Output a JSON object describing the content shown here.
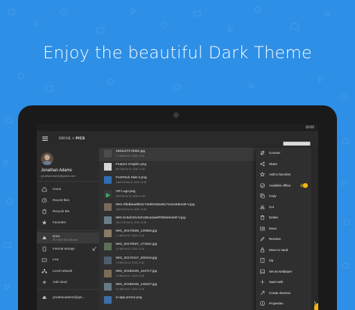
{
  "headline": "Enjoy the beautiful Dark Theme",
  "colors": {
    "background": "#2e8fe6",
    "app_dark": "#303030",
    "accent": "#f2b515"
  },
  "statusbar": {
    "time": "10:00"
  },
  "appbar": {
    "crumb_root": "DRIVE",
    "crumb_sep": ">",
    "crumb_current": "PICS",
    "icons": [
      "menu-icon",
      "sort-icon",
      "view-icon",
      "more-icon"
    ]
  },
  "drawer": {
    "user_name": "Jonathan Adams",
    "user_email": "jonathanadams@gmail.com",
    "items": [
      {
        "label": "Home",
        "icon": "home-icon"
      },
      {
        "label": "Recent files",
        "icon": "clock-icon"
      },
      {
        "label": "Recycle Bin",
        "icon": "trash-icon"
      },
      {
        "label": "Favorites",
        "icon": "star-icon"
      },
      {
        "label": "Drive",
        "sub": "35.7 GB of 50.0 GB used",
        "icon": "drive-icon"
      },
      {
        "label": "Internal storage",
        "icon": "storage-icon"
      },
      {
        "label": "FTP",
        "icon": "ftp-icon"
      },
      {
        "label": "Local network",
        "icon": "network-icon"
      },
      {
        "label": "Add cloud",
        "icon": "add-cloud-icon"
      },
      {
        "label": "jonathanadams@gm...",
        "icon": "account-icon"
      }
    ]
  },
  "files": [
    {
      "name": "1561127173061.jpg",
      "meta": "1.7 MB  Oct 11, 2019, 11:30"
    },
    {
      "name": "Feature Graphic.png",
      "meta": "66.3 KB  Oct 11, 2019, 11:30"
    },
    {
      "name": "FontPack Sale 2.png",
      "meta": "146.8 KB  Oct 11, 2019, 11:30"
    },
    {
      "name": "GP Logo.png",
      "meta": "38.5 KB  Oct 11, 2019, 11:30"
    },
    {
      "name": "IMG-2f5d6ead5b117c8d02d3a36c721ec8de448-V.jpg",
      "meta": "146.2 KB  Oct 11, 2019, 11:30"
    },
    {
      "name": "IMG-5c5efc81d10136ca2aa9f7bb9e64d4f-V.jpg",
      "meta": "191.0 KB  Oct 11, 2019, 11:30"
    },
    {
      "name": "IMG_20170506_130956.jpg",
      "meta": "7.1 MB  Oct 11, 2019, 11:30"
    },
    {
      "name": "IMG_20170507_171631.jpg",
      "meta": "3.2 MB  Oct 11, 2019, 11:30"
    },
    {
      "name": "IMG_20170317_205344.jpg",
      "meta": "1.8 MB  Oct 11, 2019, 11:30"
    },
    {
      "name": "IMG_20190225_122717.jpg",
      "meta": "2.5 MB  Oct 11, 2019, 11:30"
    },
    {
      "name": "IMG_20190225_145227.jpg",
      "meta": "2.1 MB  Oct 11, 2019, 11:30"
    },
    {
      "name": "in-app promo.png",
      "meta": ""
    }
  ],
  "context_menu": [
    {
      "label": "Convert",
      "icon": "convert-icon"
    },
    {
      "label": "Share",
      "icon": "share-icon"
    },
    {
      "label": "Add to favorites",
      "icon": "star-outline-icon"
    },
    {
      "label": "Available offline",
      "icon": "offline-icon",
      "toggle": true
    },
    {
      "label": "Copy",
      "icon": "copy-icon"
    },
    {
      "label": "Cut",
      "icon": "cut-icon"
    },
    {
      "label": "Delete",
      "icon": "delete-icon"
    },
    {
      "label": "Move",
      "icon": "move-icon"
    },
    {
      "label": "Rename",
      "icon": "rename-icon"
    },
    {
      "label": "Move to Vault",
      "icon": "vault-icon"
    },
    {
      "label": "Zip",
      "icon": "zip-icon"
    },
    {
      "label": "Set as wallpaper",
      "icon": "wallpaper-icon"
    },
    {
      "label": "Open with",
      "icon": "open-with-icon"
    },
    {
      "label": "Create shortcut",
      "icon": "shortcut-icon"
    },
    {
      "label": "Properties",
      "icon": "info-icon"
    }
  ]
}
